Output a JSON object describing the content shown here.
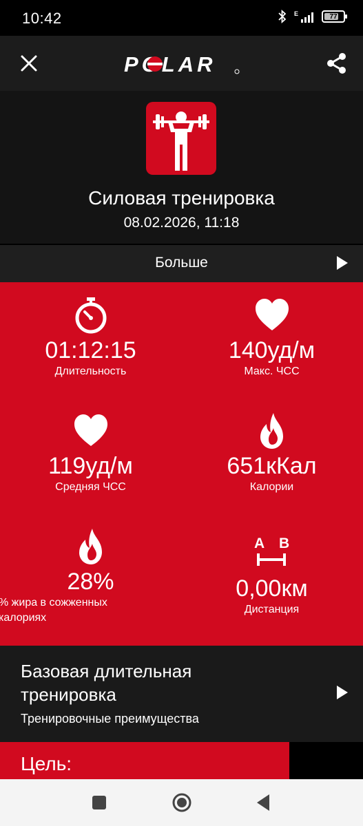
{
  "status_bar": {
    "time": "10:42",
    "network": "E",
    "battery": "77",
    "battery_level": 0.77
  },
  "app_bar": {
    "brand": "POLAR",
    "close_icon": "close-icon",
    "share_icon": "share-icon"
  },
  "session": {
    "sport_icon": "weightlifting-icon",
    "title": "Силовая тренировка",
    "datetime": "08.02.2026, 11:18"
  },
  "more": {
    "label": "Больше"
  },
  "stats": [
    {
      "icon": "stopwatch-icon",
      "value": "01:12:15",
      "label": "Длительность"
    },
    {
      "icon": "heart-icon",
      "value": "140уд/м",
      "label": "Макс. ЧСС"
    },
    {
      "icon": "heart-icon",
      "value": "119уд/м",
      "label": "Средняя ЧСС"
    },
    {
      "icon": "flame-icon",
      "value": "651кКал",
      "label": "Калории"
    },
    {
      "icon": "flame-icon",
      "value": "28%",
      "label_line1": "% жира в сожженных",
      "label_line2": "калориях"
    },
    {
      "icon": "distance-icon",
      "icon_text_a": "A",
      "icon_text_b": "B",
      "value": "0,00км",
      "label": "Дистанция"
    }
  ],
  "training_benefit": {
    "title_line1": "Базовая длительная",
    "title_line2": "тренировка",
    "subtitle": "Тренировочные преимущества"
  },
  "goal": {
    "label": "Цель:"
  },
  "colors": {
    "accent": "#d10a1f",
    "background": "#000000"
  }
}
